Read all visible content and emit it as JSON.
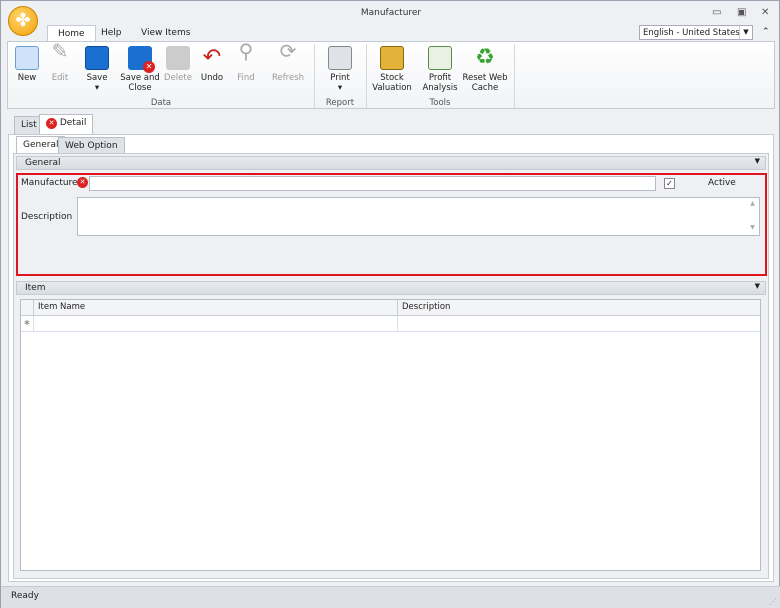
{
  "window": {
    "title": "Manufacturer"
  },
  "ribbon_tabs": [
    "Home",
    "Help",
    "View Items"
  ],
  "language": "English - United States",
  "buttons": {
    "new": "New",
    "edit": "Edit",
    "save": "Save",
    "save_close": "Save and Close",
    "delete": "Delete",
    "undo": "Undo",
    "find": "Find",
    "refresh": "Refresh",
    "print": "Print",
    "stock": "Stock Valuation",
    "profit": "Profit Analysis",
    "reset": "Reset Web Cache"
  },
  "groups": {
    "data": "Data",
    "report": "Report",
    "tools": "Tools"
  },
  "doc_tabs": [
    "List",
    "Detail"
  ],
  "inner_tabs": [
    "General",
    "Web Option"
  ],
  "general": {
    "header": "General",
    "manufacturer_label": "Manufacturer",
    "manufacturer_value": "",
    "active_label": "Active",
    "active_checked": true,
    "description_label": "Description",
    "description_value": ""
  },
  "item": {
    "header": "Item",
    "columns": [
      "Item Name",
      "Description"
    ]
  },
  "colors": {
    "highlight": "#e0141e"
  },
  "status": "Ready"
}
